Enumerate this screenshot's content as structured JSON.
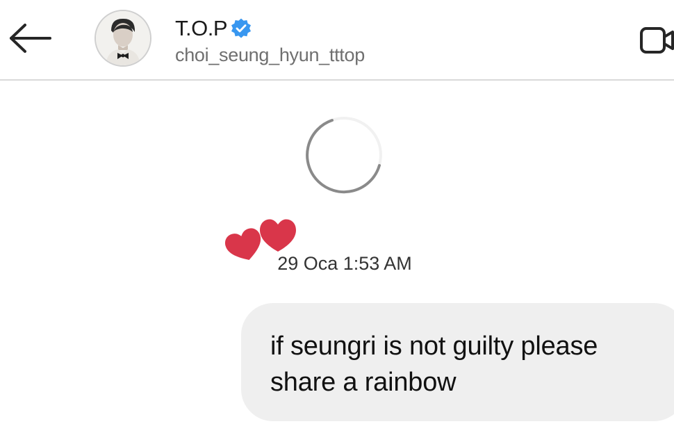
{
  "header": {
    "display_name": "T.O.P",
    "username": "choi_seung_hyun_tttop",
    "verified": true
  },
  "thread": {
    "loading": true,
    "timestamp": "29 Oca 1:53 AM",
    "reaction": "hearts",
    "messages": [
      {
        "from": "me",
        "text": "if seungri is not guilty please share a rainbow"
      }
    ]
  },
  "colors": {
    "verified_badge": "#3897f0",
    "heart": "#d9364a",
    "bubble": "#efefef",
    "divider": "#d9d9d9"
  },
  "icons": {
    "back": "arrow-left",
    "video": "video-camera",
    "verified": "verified-badge"
  }
}
